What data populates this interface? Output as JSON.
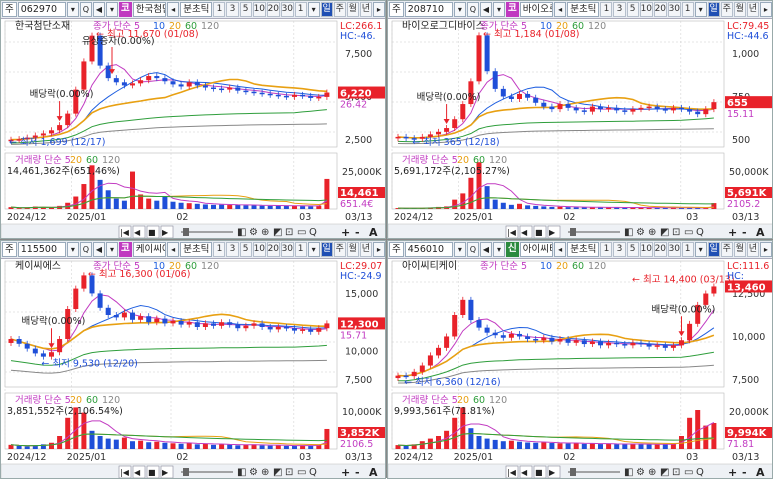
{
  "common": {
    "main_menu": "주",
    "bunchotick": "분초틱",
    "periods": [
      "1",
      "3",
      "5",
      "10",
      "20",
      "30",
      "1"
    ],
    "il": "일",
    "ju": "주",
    "wol": "월",
    "nyeon": "년",
    "price_ma_legend": [
      "종가 단순 5",
      "10",
      "20",
      "60",
      "120"
    ],
    "volume_legend": [
      "거래량 단순 5",
      "20",
      "60",
      "120"
    ],
    "x_labels": [
      "2024/12",
      "2025/01",
      "02",
      "03",
      "03/13"
    ],
    "scroll_controls": [
      "|◀",
      "◀",
      "■",
      "▶",
      "+",
      "-",
      "A"
    ],
    "colors": {
      "up": "#e8222a",
      "down": "#1f4fd8",
      "ma5": "#c23cc2",
      "ma10": "#1f5fe0",
      "ma20": "#e8a012",
      "ma60": "#2f9e3c",
      "ma120": "#888888",
      "label_bg": "#e8222a"
    }
  },
  "panes": [
    {
      "code": "062970",
      "market": "코",
      "name": "한국첨단소재",
      "high_label": "최고 11,670 (01/08)",
      "low_label": "최저 1,699 (12/17)",
      "dividend_label": "배당락(0.00%)",
      "rights_label": "유상증자(0.00%)",
      "lc": "LC:266.1",
      "hc": "HC:-46.",
      "axis": [
        "7,500",
        "5,000",
        "2,500"
      ],
      "price_box": "6,220",
      "pct_box": "26.42",
      "vol_summary": "14,461,362주(651,46%)",
      "vol_axis": [
        "25,000K",
        "14,461",
        "651.4€"
      ],
      "series": {
        "y": [
          1700,
          1750,
          1900,
          2100,
          2300,
          2600,
          3100,
          4200,
          6500,
          9200,
          11670,
          8800,
          7600,
          7200,
          6900,
          7100,
          7400,
          7800,
          7600,
          7300,
          7000,
          6800,
          7200,
          6900,
          6700,
          6600,
          6500,
          6700,
          6400,
          6300,
          6200,
          6100,
          6000,
          5900,
          5800,
          6000,
          5900,
          5700,
          5800,
          6220
        ],
        "vmax": 25000,
        "v": [
          900,
          400,
          600,
          1200,
          900,
          700,
          1500,
          3000,
          6000,
          12000,
          21000,
          14000,
          9000,
          5000,
          4000,
          18000,
          7000,
          5000,
          4000,
          6000,
          3500,
          3000,
          2800,
          2500,
          2200,
          2000,
          2100,
          1900,
          2000,
          1800,
          1700,
          1600,
          1500,
          1700,
          1600,
          1500,
          1400,
          1300,
          1600,
          14461
        ]
      },
      "ymax": 12500,
      "ymin": 1000
    },
    {
      "code": "208710",
      "market": "코",
      "name": "바이오로그디바이스",
      "high_label": "최고 1,184 (01/08)",
      "low_label": "최저 365 (12/18)",
      "dividend_label": "배당락(0.00%)",
      "rights_label": "",
      "lc": "LC:79.45",
      "hc": "HC:-44.6",
      "axis": [
        "1,000",
        "750",
        "500"
      ],
      "price_box": "655",
      "pct_box": "15.11",
      "vol_summary": "5,691,172주(2,105.27%)",
      "vol_axis": [
        "50,000K",
        "5,691K",
        "2105.2"
      ],
      "series": {
        "y": [
          380,
          370,
          365,
          380,
          400,
          420,
          450,
          520,
          640,
          820,
          1184,
          900,
          760,
          700,
          680,
          720,
          690,
          650,
          620,
          600,
          640,
          610,
          590,
          580,
          620,
          600,
          610,
          590,
          580,
          600,
          610,
          620,
          600,
          590,
          610,
          600,
          580,
          560,
          600,
          655
        ],
        "vmax": 50000,
        "v": [
          900,
          600,
          700,
          1000,
          1500,
          2000,
          2500,
          9000,
          15000,
          30000,
          45000,
          22000,
          9000,
          6000,
          4000,
          5000,
          3500,
          3000,
          2500,
          2000,
          2200,
          1800,
          1700,
          1600,
          1500,
          1400,
          1600,
          1500,
          1300,
          1400,
          1500,
          1200,
          1100,
          1300,
          1000,
          1100,
          1200,
          1000,
          900,
          5691
        ]
      },
      "ymax": 1250,
      "ymin": 300
    },
    {
      "code": "115500",
      "market": "코",
      "name": "케이씨에스",
      "high_label": "최고 16,300 (01/06)",
      "low_label": "최저 9,530 (12/20)",
      "dividend_label": "배당락(0.00%)",
      "rights_label": "",
      "lc": "LC:29.07",
      "hc": "HC:-24.9",
      "axis": [
        "15,000",
        "12,500",
        "10,000",
        "7,500"
      ],
      "price_box": "12,300",
      "pct_box": "15.71",
      "vol_summary": "3,851,552주(2,106.54%)",
      "vol_axis": [
        "10,000K",
        "3,852K",
        "2106.5"
      ],
      "series": {
        "y": [
          11000,
          10600,
          10200,
          9800,
          9530,
          9900,
          11000,
          13500,
          15200,
          16300,
          14800,
          13600,
          13000,
          12800,
          13200,
          12600,
          12900,
          12400,
          12700,
          12300,
          12500,
          12200,
          12400,
          12000,
          12300,
          12100,
          12400,
          12200,
          11900,
          12100,
          12300,
          12000,
          11800,
          12000,
          11900,
          11700,
          11800,
          11600,
          11900,
          12300
        ],
        "vmax": 10000,
        "v": [
          800,
          600,
          500,
          700,
          900,
          1200,
          2500,
          6000,
          8000,
          7000,
          3500,
          2500,
          2000,
          1800,
          2200,
          1500,
          1600,
          1300,
          1400,
          1200,
          1100,
          1000,
          1200,
          900,
          1000,
          800,
          900,
          850,
          700,
          800,
          900,
          700,
          650,
          700,
          600,
          650,
          700,
          600,
          800,
          3852
        ]
      },
      "ymax": 17000,
      "ymin": 7000
    },
    {
      "code": "456010",
      "market": "신",
      "name": "아이씨티케이",
      "high_label": "최고 14,400 (03/13)",
      "low_label": "최저 6,360 (12/16)",
      "dividend_label": "배당락(0.00%)",
      "rights_label": "",
      "lc": "LC:111.6",
      "hc": "HC:",
      "axis": [
        "12,500",
        "10,000",
        "7,500"
      ],
      "price_box": "13,460",
      "pct_box": "",
      "vol_summary": "9,993,561주(71.81%)",
      "vol_axis": [
        "20,000K",
        "9,994K",
        "71.81"
      ],
      "series": {
        "y": [
          6400,
          6360,
          6700,
          7200,
          8000,
          8600,
          9500,
          11200,
          12400,
          10800,
          10200,
          9800,
          9600,
          9400,
          9700,
          9500,
          9300,
          9200,
          9400,
          9100,
          9300,
          9000,
          9200,
          8900,
          9100,
          8800,
          9000,
          8900,
          8800,
          9000,
          8900,
          8700,
          8800,
          8600,
          8800,
          9200,
          10500,
          12000,
          12900,
          13460
        ],
        "vmax": 20000,
        "v": [
          1500,
          1200,
          1800,
          3000,
          4000,
          5000,
          7000,
          12000,
          16000,
          8000,
          5000,
          4000,
          3500,
          3000,
          3200,
          2800,
          2500,
          2400,
          2600,
          2300,
          2200,
          2100,
          2300,
          2000,
          2100,
          1900,
          2000,
          1900,
          1800,
          2000,
          1900,
          1800,
          1700,
          1800,
          1900,
          5000,
          12000,
          15000,
          9000,
          9994
        ]
      },
      "ymax": 15000,
      "ymin": 5500
    }
  ]
}
